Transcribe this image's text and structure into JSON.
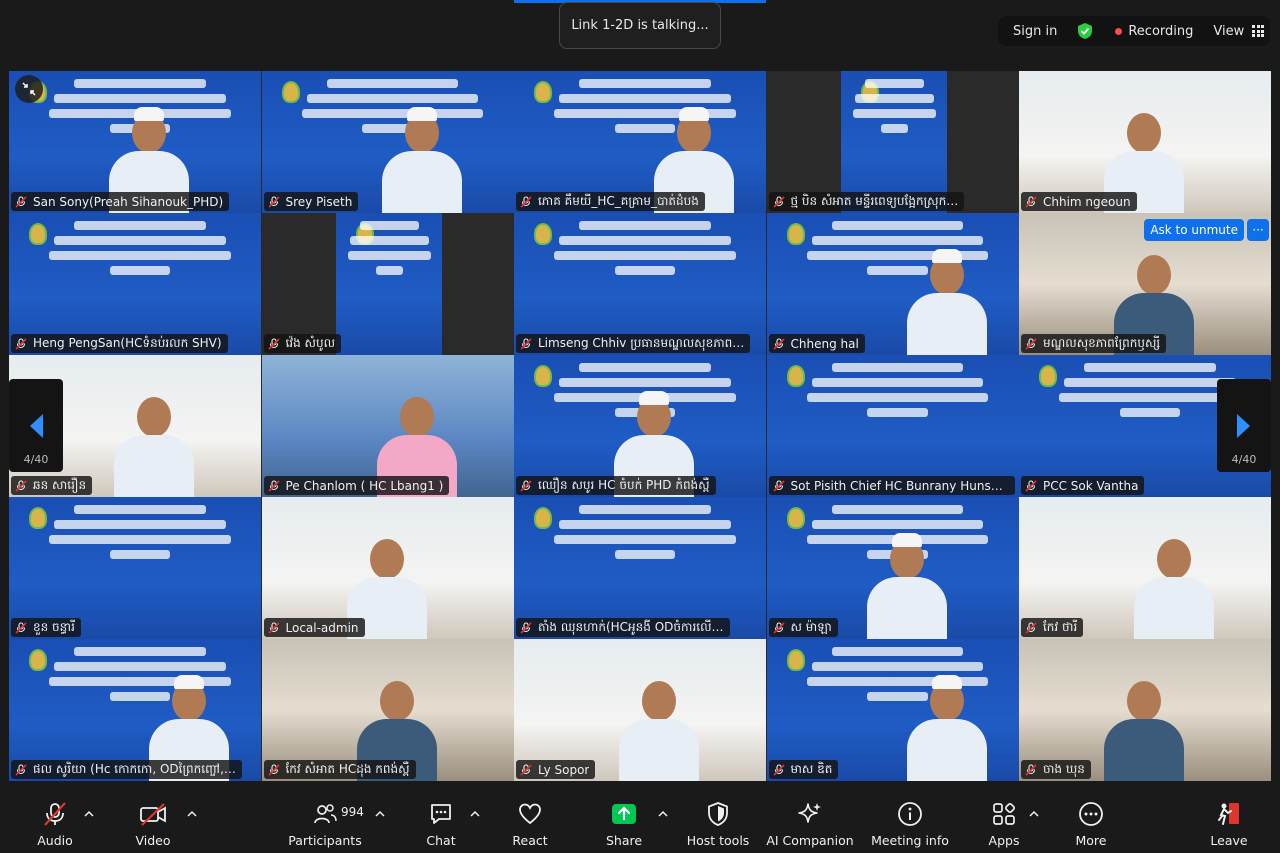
{
  "window": {
    "talking_banner": "Link 1-2D is talking..."
  },
  "top_right": {
    "sign_in": "Sign in",
    "recording": "Recording",
    "view": "View"
  },
  "gallery": {
    "page_indicator": "4/40",
    "tiles": [
      {
        "name": "San Sony(Preah Sihanouk_PHD)",
        "kind": "slide-person"
      },
      {
        "name": "Srey Piseth",
        "kind": "slide-person"
      },
      {
        "name": "ភោគ គឹមយី_HC_គគ្រាម_បាត់ដំបង",
        "kind": "slide-person"
      },
      {
        "name": "ថ្ម បិន សំអាត មន្ទីរពេទ្យបង្អែកស្រុក…",
        "kind": "narrow-slide"
      },
      {
        "name": "Chhim ngeoun",
        "kind": "room"
      },
      {
        "name": "Heng PengSan(HCទំនប់រលក SHV)",
        "kind": "slide"
      },
      {
        "name": "វ៉េង សំបូល",
        "kind": "narrow-slide"
      },
      {
        "name": "Limseng Chhiv ប្រធានមណ្ឌលសុខភាព…",
        "kind": "slide"
      },
      {
        "name": "Chheng hal",
        "kind": "slide-person"
      },
      {
        "name": "មណ្ឌលសុខភាពព្រែកឫស្សី",
        "kind": "room"
      },
      {
        "name": "ឆន សារឿន",
        "kind": "room"
      },
      {
        "name": "Pe Chanlom ( HC Lbang1 )",
        "kind": "room"
      },
      {
        "name": "ឈឿន សបូរ HC ចំបក់ PHD កំពង់ស្ពឺ",
        "kind": "slide-person"
      },
      {
        "name": "Sot Pisith Chief HC Bunrany Hunsen …",
        "kind": "slide"
      },
      {
        "name": "PCC Sok Vantha",
        "kind": "slide"
      },
      {
        "name": "ខួន ចន្ធារី",
        "kind": "slide"
      },
      {
        "name": "Local-admin",
        "kind": "room"
      },
      {
        "name": "តាំង ឈុនហាក់(HCអូនងី ODចំការលើ…",
        "kind": "slide"
      },
      {
        "name": "ស ម៉ាឡា",
        "kind": "slide-person"
      },
      {
        "name": "កែវ ថារី",
        "kind": "room"
      },
      {
        "name": "ផល សូរិយា (Hc កោកកោ, ODព្រៃកញ្ចៅ,…",
        "kind": "slide-person"
      },
      {
        "name": "កែវ សំអាត HCដុង កពង់ស្ពឺ",
        "kind": "room"
      },
      {
        "name": "Ly Sopor",
        "kind": "room"
      },
      {
        "name": "មាស ឌិត",
        "kind": "slide-person"
      },
      {
        "name": "ចាង ឃុន",
        "kind": "room"
      }
    ],
    "ask_to_unmute": "Ask to unmute",
    "more": "···"
  },
  "toolbar": {
    "audio": "Audio",
    "video": "Video",
    "participants": "Participants",
    "participants_count": "994",
    "chat": "Chat",
    "react": "React",
    "share": "Share",
    "host_tools": "Host tools",
    "ai_companion": "AI Companion",
    "meeting_info": "Meeting info",
    "apps": "Apps",
    "more": "More",
    "leave": "Leave"
  },
  "colors": {
    "accent": "#0e71eb",
    "share_green": "#00c853",
    "recording_red": "#ff4a4a",
    "leave_red": "#e0342f"
  }
}
